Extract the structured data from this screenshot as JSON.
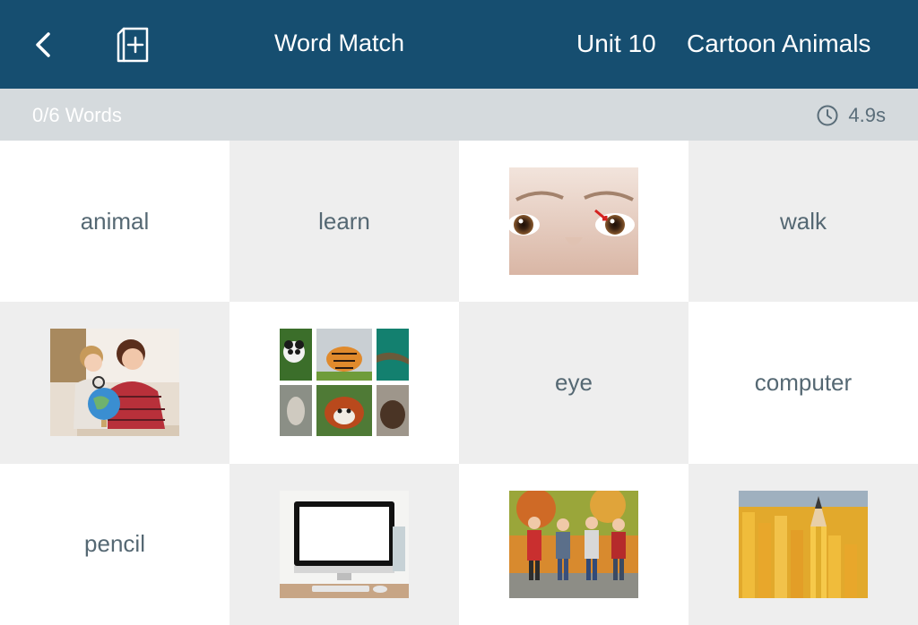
{
  "header": {
    "title": "Word Match",
    "unit": "Unit 10",
    "topic": "Cartoon Animals",
    "colors": {
      "bg": "#164e70",
      "text": "#ffffff"
    }
  },
  "status": {
    "progress": "0/6 Words",
    "timer": "4.9s",
    "colors": {
      "bg": "#d5dadd",
      "timer_text": "#5a6d79"
    }
  },
  "cards": [
    {
      "type": "word",
      "text": "animal"
    },
    {
      "type": "word",
      "text": "learn"
    },
    {
      "type": "image",
      "icon": "eye-photo"
    },
    {
      "type": "word",
      "text": "walk"
    },
    {
      "type": "image",
      "icon": "learn-photo"
    },
    {
      "type": "image",
      "icon": "animals-collage-photo"
    },
    {
      "type": "word",
      "text": "eye"
    },
    {
      "type": "word",
      "text": "computer"
    },
    {
      "type": "word",
      "text": "pencil"
    },
    {
      "type": "image",
      "icon": "computer-photo"
    },
    {
      "type": "image",
      "icon": "walk-photo"
    },
    {
      "type": "image",
      "icon": "pencils-photo"
    }
  ]
}
